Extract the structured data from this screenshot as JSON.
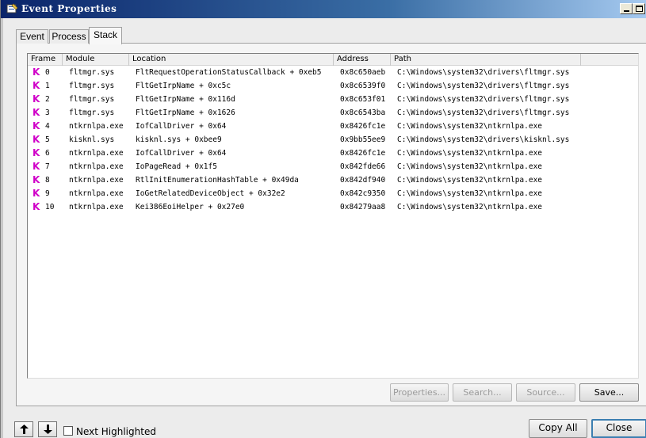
{
  "window": {
    "title": "Event Properties"
  },
  "tabs": [
    {
      "label": "Event"
    },
    {
      "label": "Process"
    },
    {
      "label": "Stack"
    }
  ],
  "active_tab": "Stack",
  "grid": {
    "columns": [
      "Frame",
      "Module",
      "Location",
      "Address",
      "Path"
    ],
    "rows": [
      {
        "frame": "0",
        "module": "fltmgr.sys",
        "location": "FltRequestOperationStatusCallback + 0xeb5",
        "address": "0x8c650aeb",
        "path": "C:\\Windows\\system32\\drivers\\fltmgr.sys"
      },
      {
        "frame": "1",
        "module": "fltmgr.sys",
        "location": "FltGetIrpName + 0xc5c",
        "address": "0x8c6539f0",
        "path": "C:\\Windows\\system32\\drivers\\fltmgr.sys"
      },
      {
        "frame": "2",
        "module": "fltmgr.sys",
        "location": "FltGetIrpName + 0x116d",
        "address": "0x8c653f01",
        "path": "C:\\Windows\\system32\\drivers\\fltmgr.sys"
      },
      {
        "frame": "3",
        "module": "fltmgr.sys",
        "location": "FltGetIrpName + 0x1626",
        "address": "0x8c6543ba",
        "path": "C:\\Windows\\system32\\drivers\\fltmgr.sys"
      },
      {
        "frame": "4",
        "module": "ntkrnlpa.exe",
        "location": "IofCallDriver + 0x64",
        "address": "0x8426fc1e",
        "path": "C:\\Windows\\system32\\ntkrnlpa.exe"
      },
      {
        "frame": "5",
        "module": "kisknl.sys",
        "location": "kisknl.sys + 0xbee9",
        "address": "0x9bb55ee9",
        "path": "C:\\Windows\\system32\\drivers\\kisknl.sys"
      },
      {
        "frame": "6",
        "module": "ntkrnlpa.exe",
        "location": "IofCallDriver + 0x64",
        "address": "0x8426fc1e",
        "path": "C:\\Windows\\system32\\ntkrnlpa.exe"
      },
      {
        "frame": "7",
        "module": "ntkrnlpa.exe",
        "location": "IoPageRead + 0x1f5",
        "address": "0x842fde66",
        "path": "C:\\Windows\\system32\\ntkrnlpa.exe"
      },
      {
        "frame": "8",
        "module": "ntkrnlpa.exe",
        "location": "RtlInitEnumerationHashTable + 0x49da",
        "address": "0x842df940",
        "path": "C:\\Windows\\system32\\ntkrnlpa.exe"
      },
      {
        "frame": "9",
        "module": "ntkrnlpa.exe",
        "location": "IoGetRelatedDeviceObject + 0x32e2",
        "address": "0x842c9350",
        "path": "C:\\Windows\\system32\\ntkrnlpa.exe"
      },
      {
        "frame": "10",
        "module": "ntkrnlpa.exe",
        "location": "Kei386EoiHelper + 0x27e0",
        "address": "0x84279aa8",
        "path": "C:\\Windows\\system32\\ntkrnlpa.exe"
      }
    ],
    "frame_icon_glyph": "K",
    "frame_icon_color": "#d000c8"
  },
  "buttons": {
    "properties": "Properties...",
    "search": "Search...",
    "source": "Source...",
    "save": "Save...",
    "copy_all": "Copy All",
    "close": "Close"
  },
  "footer": {
    "next_highlighted_label": "Next Highlighted",
    "next_highlighted_checked": false
  },
  "icons": {
    "up": "arrow-up-icon",
    "down": "arrow-down-icon"
  }
}
